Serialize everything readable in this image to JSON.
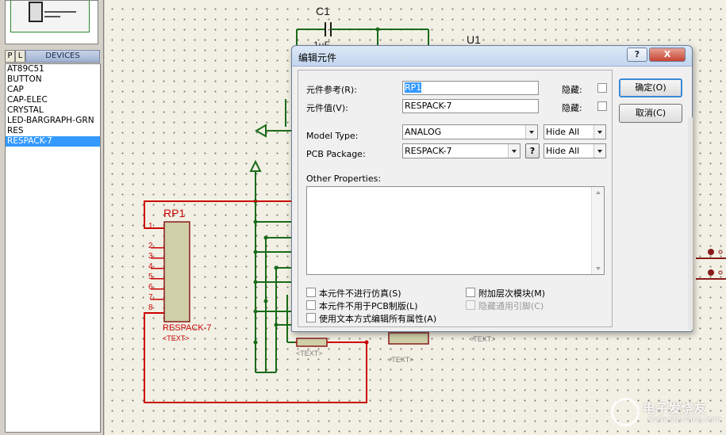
{
  "left_panel": {
    "tabs": [
      "P",
      "L"
    ],
    "header": "DEVICES",
    "devices": [
      "AT89C51",
      "BUTTON",
      "CAP",
      "CAP-ELEC",
      "CRYSTAL",
      "LED-BARGRAPH-GRN",
      "RES",
      "RESPACK-7"
    ],
    "selected_device": "RESPACK-7"
  },
  "schematic": {
    "capacitor_label": "C1",
    "capacitor_value_partial": "1μF",
    "chip_label_partial": "U1",
    "respack_ref": "RP1",
    "respack_name": "RESPACK-7",
    "respack_text": "<TEXT>",
    "pin_numbers": [
      "1",
      "2",
      "3",
      "4",
      "5",
      "6",
      "7",
      "8"
    ],
    "text_placeholder_1": "<TEXT>",
    "text_placeholder_2": "<TEXT>",
    "text_placeholder_3": "<TEXT>",
    "colors": {
      "wire_red": "#cc0000",
      "wire_green": "#1a6b1a",
      "grid_dot": "#7a7a6a"
    }
  },
  "dialog": {
    "title": "编辑元件",
    "help_button": "?",
    "close_button": "X",
    "fields": {
      "part_reference_label": "元件参考(R):",
      "part_reference_value": "RP1",
      "hidden_label_1": "隐藏:",
      "part_value_label": "元件值(V):",
      "part_value_value": "RESPACK-7",
      "hidden_label_2": "隐藏:",
      "model_type_label": "Model Type:",
      "model_type_value": "ANALOG",
      "model_type_vis": "Hide All",
      "pcb_package_label": "PCB Package:",
      "pcb_package_value": "RESPACK-7",
      "pcb_package_help": "?",
      "pcb_package_vis": "Hide All",
      "other_properties_label": "Other Properties:",
      "other_properties_value": ""
    },
    "checkboxes": {
      "exclude_sim": "本元件不进行仿真(S)",
      "exclude_pcb": "本元件不用于PCB制版(L)",
      "edit_as_text": "使用文本方式编辑所有属性(A)",
      "attach_hier": "附加层次模块(M)",
      "hide_common_pins": "隐藏通用引脚(C)"
    },
    "ok_button": "确定(O)",
    "cancel_button": "取消(C)"
  },
  "watermark": {
    "text": "电子发烧友",
    "sub": "www.elecfans.com"
  }
}
